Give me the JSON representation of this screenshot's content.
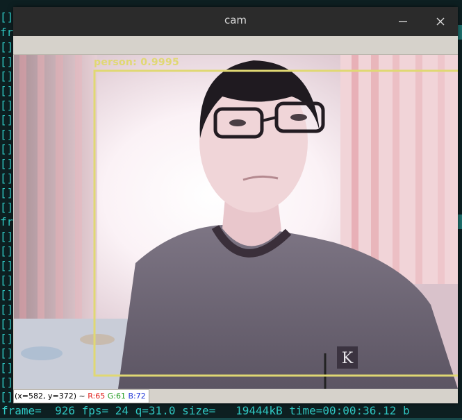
{
  "window": {
    "title": "cam",
    "minimize_icon": "minimize-icon",
    "close_icon": "close-icon"
  },
  "detection": {
    "label": "person: 0.9995",
    "color": "#e0d873"
  },
  "pixel_info": {
    "coords": "(x=582, y=372) ~ ",
    "r": "R:65",
    "g": "G:61",
    "b": "B:72"
  },
  "terminal": {
    "bracket": "[]",
    "frame_prefix": "fr",
    "status_line": "frame=  926 fps= 24 q=31.0 size=   19444kB time=00:00:36.12 b",
    "accent_color": "#2fc7c2"
  }
}
